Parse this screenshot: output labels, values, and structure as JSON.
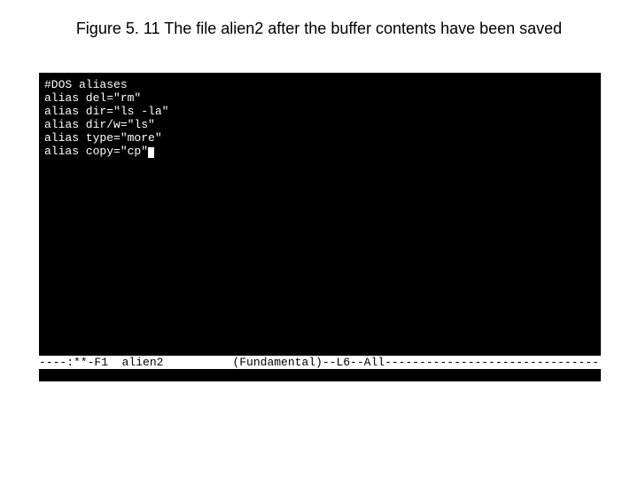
{
  "caption": "Figure 5. 11  The file alien2 after the buffer contents have been saved",
  "editor": {
    "lines": [
      "#DOS aliases",
      "alias del=\"rm\"",
      "alias dir=\"ls -la\"",
      "alias dir/w=\"ls\"",
      "alias type=\"more\"",
      "alias copy=\"cp\""
    ],
    "modeline_left": "----:**-F1  alien2          ",
    "modeline_mode": "(Fundamental)--L6--All",
    "modeline_fill": "---------------------------------"
  }
}
